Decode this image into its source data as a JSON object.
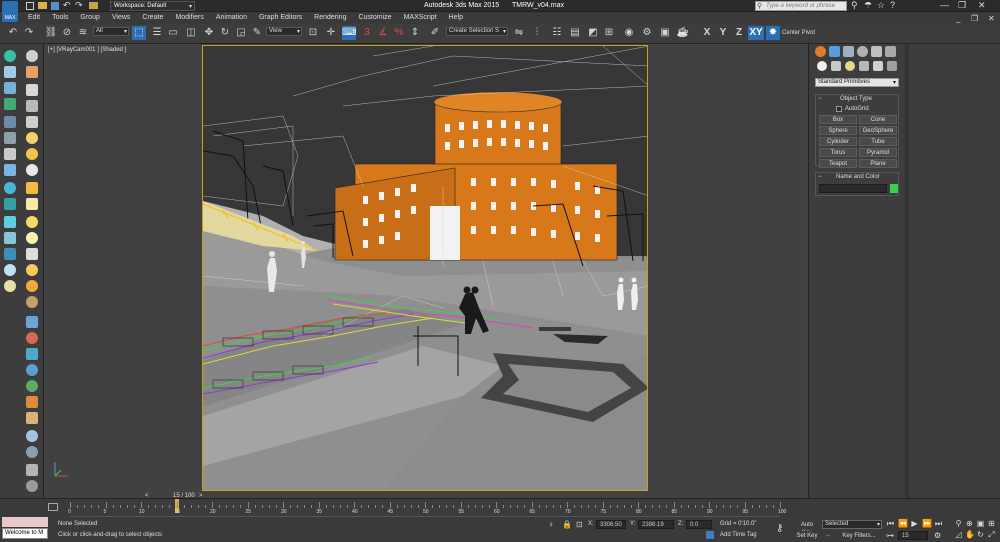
{
  "titlebar": {
    "logo": "MAX",
    "workspace": "Workspace: Default",
    "app_title": "Autodesk 3ds Max  2015",
    "file_name": "TMRW_v04.max",
    "search_placeholder": "Type a keyword or phrase"
  },
  "menu": [
    "Edit",
    "Tools",
    "Group",
    "Views",
    "Create",
    "Modifiers",
    "Animation",
    "Graph Editors",
    "Rendering",
    "Customize",
    "MAXScript",
    "Help"
  ],
  "toolbar": {
    "filter": "All",
    "ref_coord": "View",
    "selection_set": "Create Selection S",
    "axes": [
      "X",
      "Y",
      "Z",
      "XY"
    ],
    "center_pivot": "Center Pivot"
  },
  "viewport": {
    "label": "[+] [VRayCam001 ] [Shaded ]",
    "accent": "#c8a018",
    "building_color": "#d7781a"
  },
  "command_panel": {
    "category": "Standard Primitives",
    "object_type_title": "Object Type",
    "autogrid_label": "AutoGrid",
    "primitives": [
      "Box",
      "Cone",
      "Sphere",
      "GeoSphere",
      "Cylinder",
      "Tube",
      "Torus",
      "Pyramid",
      "Teapot",
      "Plane"
    ],
    "name_color_title": "Name and Color",
    "object_color": "#3ccf4e"
  },
  "timeline": {
    "frame_counter": "15 / 100",
    "current_frame": 15,
    "total_frames": 100,
    "ruler": [
      "0",
      "5",
      "10",
      "15",
      "20",
      "25",
      "30",
      "35",
      "40",
      "45",
      "50",
      "55",
      "60",
      "65",
      "70",
      "75",
      "80",
      "85",
      "90",
      "95",
      "100"
    ]
  },
  "status": {
    "script_listener": "Welcome to M",
    "selection": "None Selected",
    "prompt": "Click or click-and-drag to select objects",
    "x_label": "X:",
    "x_value": "3306.50",
    "y_label": "Y:",
    "y_value": "2398.19",
    "z_label": "Z:",
    "z_value": "0.0",
    "grid": "Grid = 0'10.0\"",
    "add_time_tag": "Add Time Tag",
    "auto_key": "Auto Key",
    "set_key": "Set Key",
    "key_mode": "Selected",
    "key_filters": "Key Filters...",
    "frame_field": "15"
  }
}
